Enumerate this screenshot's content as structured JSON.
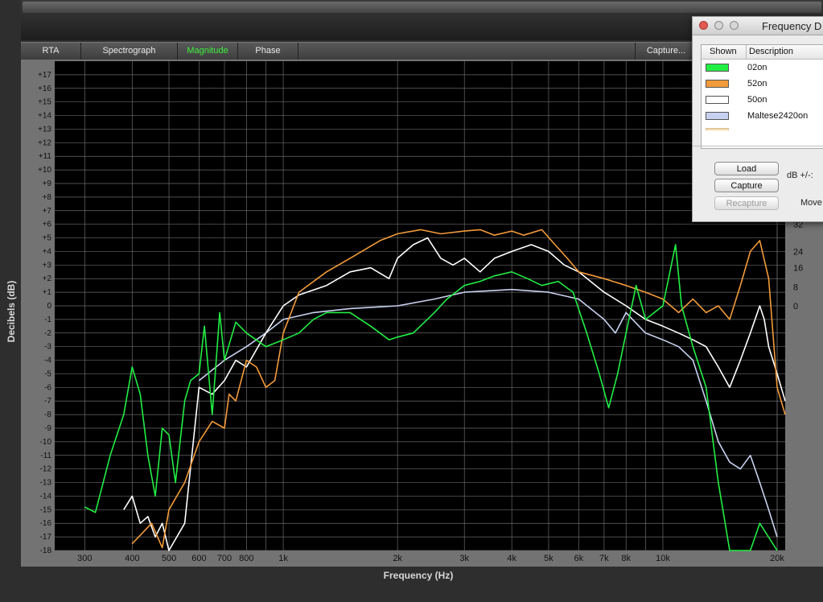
{
  "tabs": [
    "RTA",
    "Spectrograph",
    "Magnitude",
    "Phase",
    "Capture..."
  ],
  "active_tab": "Magnitude",
  "colors": {
    "plot_bg": "#000000",
    "grid": "#6a6a6a",
    "frame": "#737373",
    "active_tab": "#3df03d"
  },
  "chart_data": {
    "type": "line",
    "xlabel": "Frequency (Hz)",
    "ylabel": "Decibels (dB)",
    "x_scale": "log",
    "xlim": [
      250,
      21000
    ],
    "ylim": [
      -18,
      18
    ],
    "x_ticks": [
      {
        "v": 300,
        "l": "300"
      },
      {
        "v": 400,
        "l": "400"
      },
      {
        "v": 500,
        "l": "500"
      },
      {
        "v": 600,
        "l": "600"
      },
      {
        "v": 700,
        "l": "700"
      },
      {
        "v": 800,
        "l": "800"
      },
      {
        "v": 1000,
        "l": "1k"
      },
      {
        "v": 2000,
        "l": "2k"
      },
      {
        "v": 3000,
        "l": "3k"
      },
      {
        "v": 4000,
        "l": "4k"
      },
      {
        "v": 5000,
        "l": "5k"
      },
      {
        "v": 6000,
        "l": "6k"
      },
      {
        "v": 7000,
        "l": "7k"
      },
      {
        "v": 8000,
        "l": "8k"
      },
      {
        "v": 10000,
        "l": "10k"
      },
      {
        "v": 20000,
        "l": "20k"
      }
    ],
    "y_ticks": [
      17,
      16,
      15,
      14,
      13,
      12,
      11,
      10,
      9,
      8,
      7,
      6,
      5,
      4,
      3,
      2,
      1,
      0,
      -1,
      -2,
      -3,
      -4,
      -5,
      -6,
      -7,
      -8,
      -9,
      -10,
      -11,
      -12,
      -13,
      -14,
      -15,
      -16,
      -17,
      -18
    ],
    "right_axis_ticks": [
      {
        "v": 6.0,
        "l": "32"
      },
      {
        "v": 4.0,
        "l": "24"
      },
      {
        "v": 2.8,
        "l": "16"
      },
      {
        "v": 1.4,
        "l": "8"
      },
      {
        "v": 0,
        "l": "0"
      }
    ],
    "series": [
      {
        "name": "02on",
        "color": "#22ee44",
        "points": [
          [
            300,
            -14.8
          ],
          [
            320,
            -15.2
          ],
          [
            350,
            -11
          ],
          [
            380,
            -8
          ],
          [
            400,
            -4.5
          ],
          [
            420,
            -6.5
          ],
          [
            440,
            -11
          ],
          [
            460,
            -14
          ],
          [
            480,
            -9
          ],
          [
            500,
            -9.5
          ],
          [
            520,
            -13
          ],
          [
            550,
            -7
          ],
          [
            570,
            -5.5
          ],
          [
            600,
            -5
          ],
          [
            620,
            -1.5
          ],
          [
            650,
            -8
          ],
          [
            680,
            -0.5
          ],
          [
            700,
            -4
          ],
          [
            750,
            -1.2
          ],
          [
            800,
            -2
          ],
          [
            900,
            -3
          ],
          [
            1000,
            -2.5
          ],
          [
            1100,
            -2
          ],
          [
            1200,
            -1
          ],
          [
            1300,
            -0.5
          ],
          [
            1500,
            -0.5
          ],
          [
            1700,
            -1.5
          ],
          [
            1900,
            -2.5
          ],
          [
            2000,
            -2.3
          ],
          [
            2200,
            -2
          ],
          [
            2500,
            -0.5
          ],
          [
            2700,
            0.5
          ],
          [
            3000,
            1.5
          ],
          [
            3300,
            1.8
          ],
          [
            3600,
            2.2
          ],
          [
            4000,
            2.5
          ],
          [
            4400,
            2
          ],
          [
            4800,
            1.5
          ],
          [
            5300,
            1.8
          ],
          [
            5800,
            1
          ],
          [
            6300,
            -2
          ],
          [
            6800,
            -5
          ],
          [
            7200,
            -7.5
          ],
          [
            7600,
            -5
          ],
          [
            8000,
            -2
          ],
          [
            8500,
            1.5
          ],
          [
            9000,
            -1
          ],
          [
            10000,
            0
          ],
          [
            10800,
            4.5
          ],
          [
            11200,
            0
          ],
          [
            12000,
            -3
          ],
          [
            13000,
            -6
          ],
          [
            14000,
            -13
          ],
          [
            15000,
            -18
          ],
          [
            17000,
            -18
          ],
          [
            18000,
            -16
          ],
          [
            20000,
            -18
          ]
        ]
      },
      {
        "name": "52on",
        "color": "#f39b3a",
        "points": [
          [
            400,
            -17.5
          ],
          [
            450,
            -16
          ],
          [
            480,
            -17.8
          ],
          [
            500,
            -15
          ],
          [
            550,
            -13
          ],
          [
            600,
            -10
          ],
          [
            650,
            -8.5
          ],
          [
            700,
            -9
          ],
          [
            720,
            -6.5
          ],
          [
            750,
            -7
          ],
          [
            800,
            -4
          ],
          [
            850,
            -4.5
          ],
          [
            900,
            -6
          ],
          [
            950,
            -5.5
          ],
          [
            1000,
            -2
          ],
          [
            1100,
            1
          ],
          [
            1300,
            2.5
          ],
          [
            1500,
            3.5
          ],
          [
            1800,
            4.8
          ],
          [
            2000,
            5.3
          ],
          [
            2300,
            5.6
          ],
          [
            2600,
            5.3
          ],
          [
            3000,
            5.5
          ],
          [
            3300,
            5.6
          ],
          [
            3600,
            5.2
          ],
          [
            4000,
            5.5
          ],
          [
            4300,
            5.2
          ],
          [
            4800,
            5.6
          ],
          [
            5200,
            4.5
          ],
          [
            5600,
            3.5
          ],
          [
            6000,
            2.5
          ],
          [
            7000,
            2
          ],
          [
            8000,
            1.5
          ],
          [
            9000,
            1
          ],
          [
            10000,
            0.5
          ],
          [
            11000,
            -0.5
          ],
          [
            12000,
            0.5
          ],
          [
            13000,
            -0.5
          ],
          [
            14000,
            0
          ],
          [
            15000,
            -1
          ],
          [
            16000,
            1.5
          ],
          [
            17000,
            4
          ],
          [
            18000,
            4.8
          ],
          [
            19000,
            2
          ],
          [
            20000,
            -6
          ],
          [
            21000,
            -8
          ]
        ]
      },
      {
        "name": "50on",
        "color": "#ffffff",
        "points": [
          [
            380,
            -15
          ],
          [
            400,
            -14
          ],
          [
            420,
            -16
          ],
          [
            440,
            -15.5
          ],
          [
            460,
            -17
          ],
          [
            480,
            -16
          ],
          [
            500,
            -18
          ],
          [
            550,
            -16
          ],
          [
            600,
            -6
          ],
          [
            650,
            -6.5
          ],
          [
            700,
            -5.5
          ],
          [
            750,
            -4
          ],
          [
            800,
            -4.5
          ],
          [
            900,
            -2
          ],
          [
            1000,
            0
          ],
          [
            1100,
            0.8
          ],
          [
            1300,
            1.5
          ],
          [
            1500,
            2.5
          ],
          [
            1700,
            2.8
          ],
          [
            1900,
            2
          ],
          [
            2000,
            3.5
          ],
          [
            2200,
            4.5
          ],
          [
            2400,
            5
          ],
          [
            2600,
            3.5
          ],
          [
            2800,
            3
          ],
          [
            3000,
            3.5
          ],
          [
            3300,
            2.5
          ],
          [
            3600,
            3.5
          ],
          [
            4000,
            4
          ],
          [
            4500,
            4.5
          ],
          [
            5000,
            4
          ],
          [
            5500,
            3
          ],
          [
            6000,
            2.5
          ],
          [
            7000,
            1
          ],
          [
            8000,
            0
          ],
          [
            9000,
            -1
          ],
          [
            10000,
            -1.5
          ],
          [
            11000,
            -2
          ],
          [
            12000,
            -2.5
          ],
          [
            13000,
            -3
          ],
          [
            14000,
            -4.5
          ],
          [
            15000,
            -6
          ],
          [
            16000,
            -4
          ],
          [
            17000,
            -2
          ],
          [
            18000,
            0
          ],
          [
            18500,
            -1
          ],
          [
            19000,
            -3
          ],
          [
            20000,
            -5
          ],
          [
            21000,
            -7
          ]
        ]
      },
      {
        "name": "Maltese2420on",
        "color": "#c8d2f0",
        "points": [
          [
            600,
            -5.5
          ],
          [
            700,
            -4
          ],
          [
            800,
            -3
          ],
          [
            900,
            -2
          ],
          [
            1000,
            -1
          ],
          [
            1200,
            -0.5
          ],
          [
            1500,
            -0.2
          ],
          [
            2000,
            0
          ],
          [
            2500,
            0.5
          ],
          [
            3000,
            1
          ],
          [
            4000,
            1.2
          ],
          [
            5000,
            1
          ],
          [
            6000,
            0.5
          ],
          [
            7000,
            -1
          ],
          [
            7500,
            -2
          ],
          [
            8000,
            -0.5
          ],
          [
            9000,
            -2
          ],
          [
            10000,
            -2.5
          ],
          [
            11000,
            -3
          ],
          [
            12000,
            -4
          ],
          [
            13000,
            -7
          ],
          [
            14000,
            -10
          ],
          [
            15000,
            -11.5
          ],
          [
            16000,
            -12
          ],
          [
            17000,
            -11
          ],
          [
            18000,
            -13
          ],
          [
            19000,
            -15
          ],
          [
            20000,
            -17
          ]
        ]
      }
    ]
  },
  "dialog": {
    "title": "Frequency D",
    "col_shown": "Shown",
    "col_description": "Description",
    "rows": [
      {
        "label": "02on",
        "color": "#22ee44"
      },
      {
        "label": "52on",
        "color": "#f39b3a"
      },
      {
        "label": "50on",
        "color": "#ffffff"
      },
      {
        "label": "Maltese2420on",
        "color": "#c8d2f0"
      }
    ],
    "load": "Load",
    "capture": "Capture",
    "recapture": "Recapture",
    "db_label": "dB +/-:",
    "move_label": "Move"
  }
}
